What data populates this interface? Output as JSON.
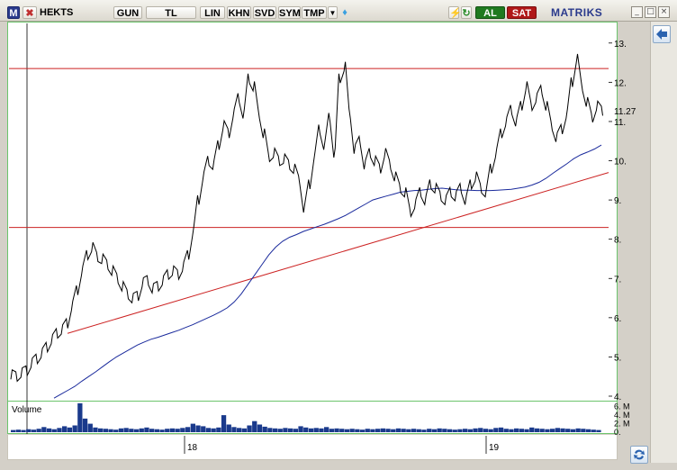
{
  "toolbar": {
    "logo_letter": "M",
    "symbol": "HEKTS",
    "period": "GUN",
    "currency": "TL",
    "buttons": [
      "LIN",
      "KHN",
      "SVD",
      "SYM",
      "TMP"
    ],
    "buy_label": "AL",
    "sell_label": "SAT",
    "brand": "MATRIKS",
    "colors": {
      "buy": "#1f7a1f",
      "sell": "#b01818",
      "brand": "#2a3a8c"
    }
  },
  "chart_data": {
    "type": "line",
    "title": "",
    "xlabel": "",
    "ylabel": "",
    "ylim": [
      4,
      13.5
    ],
    "y_ticks": [
      "4.",
      "5.",
      "6.",
      "7.",
      "8.",
      "9.",
      "10.",
      "11.",
      "12.",
      "13."
    ],
    "x_ticks": [
      "18",
      "19"
    ],
    "last_value": "11.27",
    "series": [
      {
        "values": [
          4.55,
          4.5,
          4.6,
          4.65,
          4.85,
          4.95,
          5.1,
          5.25,
          5.45,
          5.6,
          5.7,
          5.85,
          6.3,
          6.7,
          7.2,
          7.6,
          7.8,
          7.55,
          7.5,
          7.35,
          7.2,
          7.0,
          6.8,
          6.6,
          6.5,
          6.55,
          6.9,
          6.95,
          6.75,
          6.8,
          6.95,
          7.1,
          7.2,
          7.1,
          7.3,
          7.6,
          8.2,
          9.0,
          9.6,
          10.0,
          9.9,
          10.4,
          10.9,
          10.7,
          11.2,
          11.6,
          11.2,
          12.1,
          11.9,
          11.2,
          10.7,
          10.1,
          10.2,
          10.0,
          10.05,
          9.9,
          9.8,
          9.5,
          8.8,
          9.4,
          10.1,
          10.8,
          10.4,
          11.1,
          10.2,
          12.1,
          12.4,
          11.2,
          10.3,
          10.5,
          9.9,
          10.2,
          10.0,
          9.8,
          10.2,
          9.9,
          9.6,
          9.3,
          9.2,
          8.7,
          8.9,
          9.2,
          9.0,
          9.4,
          9.3,
          9.1,
          9.0,
          9.2,
          9.1,
          9.3,
          9.0,
          9.4,
          9.6,
          9.3,
          9.2,
          9.8,
          10.2,
          10.7,
          11.0,
          11.3,
          11.0,
          11.4,
          11.9,
          11.4,
          11.6,
          11.8,
          11.4,
          10.9,
          10.6,
          10.8,
          11.2,
          12.0,
          12.6,
          11.9,
          11.5,
          11.1,
          11.4,
          11.27
        ]
      },
      {
        "name": "",
        "values": [
          3.95,
          4.05,
          4.15,
          4.25,
          4.38,
          4.5,
          4.62,
          4.75,
          4.88,
          5.0,
          5.1,
          5.2,
          5.3,
          5.38,
          5.45,
          5.5,
          5.56,
          5.62,
          5.68,
          5.75,
          5.82,
          5.9,
          5.98,
          6.06,
          6.15,
          6.25,
          6.4,
          6.6,
          6.85,
          7.1,
          7.35,
          7.6,
          7.8,
          7.95,
          8.05,
          8.12,
          8.2,
          8.26,
          8.32,
          8.38,
          8.45,
          8.52,
          8.6,
          8.7,
          8.8,
          8.9,
          9.0,
          9.05,
          9.1,
          9.15,
          9.2,
          9.22,
          9.24,
          9.25,
          9.27,
          9.29,
          9.3,
          9.28,
          9.26,
          9.25,
          9.25,
          9.24,
          9.24,
          9.24,
          9.25,
          9.26,
          9.27,
          9.3,
          9.33,
          9.38,
          9.45,
          9.55,
          9.68,
          9.8,
          9.92,
          10.05,
          10.15,
          10.22,
          10.3,
          10.4
        ]
      }
    ],
    "resistance_levels": [
      12.35,
      8.3
    ],
    "trendline": {
      "start": 5.6,
      "end": 9.7
    },
    "volume": {
      "label": "Volume",
      "y_ticks": [
        "6. M",
        "4. M",
        "2. M",
        "0."
      ],
      "ylim": [
        0,
        7
      ],
      "values": [
        0.5,
        0.6,
        0.5,
        0.7,
        0.6,
        0.8,
        1.2,
        0.9,
        0.7,
        1.0,
        1.4,
        1.1,
        1.6,
        6.8,
        3.2,
        2.0,
        1.1,
        0.9,
        0.8,
        0.7,
        0.6,
        0.9,
        1.0,
        0.8,
        0.7,
        0.9,
        1.1,
        0.8,
        0.7,
        0.6,
        0.8,
        0.9,
        0.8,
        1.0,
        1.2,
        2.0,
        1.6,
        1.4,
        1.0,
        0.9,
        1.1,
        4.0,
        1.8,
        1.2,
        1.0,
        0.9,
        1.6,
        2.6,
        1.8,
        1.3,
        1.0,
        0.9,
        0.8,
        1.0,
        0.9,
        0.8,
        1.4,
        1.1,
        0.9,
        1.0,
        0.9,
        1.2,
        0.8,
        0.9,
        0.8,
        0.7,
        0.8,
        0.7,
        0.6,
        0.8,
        0.7,
        0.8,
        0.9,
        0.8,
        0.7,
        0.9,
        0.8,
        0.7,
        0.8,
        0.7,
        0.6,
        0.8,
        0.7,
        0.9,
        0.8,
        0.7,
        0.6,
        0.7,
        0.8,
        0.7,
        0.9,
        1.0,
        0.8,
        0.7,
        1.0,
        1.1,
        0.8,
        0.7,
        0.9,
        0.8,
        0.7,
        1.1,
        0.9,
        0.8,
        0.7,
        0.8,
        1.0,
        0.9,
        0.8,
        0.7,
        0.9,
        0.8,
        0.7,
        0.6,
        0.5
      ]
    }
  }
}
